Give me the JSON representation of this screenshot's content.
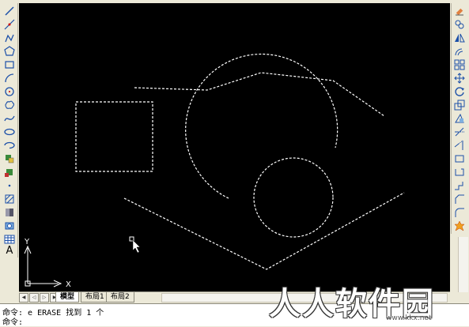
{
  "colors": {
    "canvas": "#000000",
    "dashed_entities": "#ffffff",
    "ucs_icon": "#ffffff",
    "toolbar_bg": "#ece9d8"
  },
  "left_toolbar": {
    "tools": [
      "line-icon",
      "construction-line-icon",
      "polyline-icon",
      "polygon-icon",
      "rectangle-icon",
      "arc-icon",
      "circle-icon",
      "revision-cloud-icon",
      "spline-icon",
      "ellipse-icon",
      "ellipse-arc-icon",
      "insert-block-icon",
      "make-block-icon",
      "point-icon",
      "hatch-icon",
      "gradient-icon",
      "region-icon",
      "table-icon",
      "multiline-text-icon"
    ]
  },
  "right_toolbar": {
    "tools": [
      "erase-icon",
      "copy-icon",
      "mirror-icon",
      "offset-icon",
      "array-icon",
      "move-icon",
      "rotate-icon",
      "scale-icon",
      "stretch-icon",
      "trim-icon",
      "extend-icon",
      "break-at-point-icon",
      "break-icon",
      "join-icon",
      "chamfer-icon",
      "fillet-icon",
      "explode-icon"
    ]
  },
  "ucs": {
    "x_label": "X",
    "y_label": "Y"
  },
  "tabs": {
    "items": [
      {
        "label": "模型",
        "active": true
      },
      {
        "label": "布局1",
        "active": false
      },
      {
        "label": "布局2",
        "active": false
      }
    ]
  },
  "command": {
    "line1": "命令: e ERASE 找到 1 个",
    "line2": "命令:"
  },
  "watermark": {
    "text": "人人软件园",
    "url": "www.kkx.net"
  }
}
